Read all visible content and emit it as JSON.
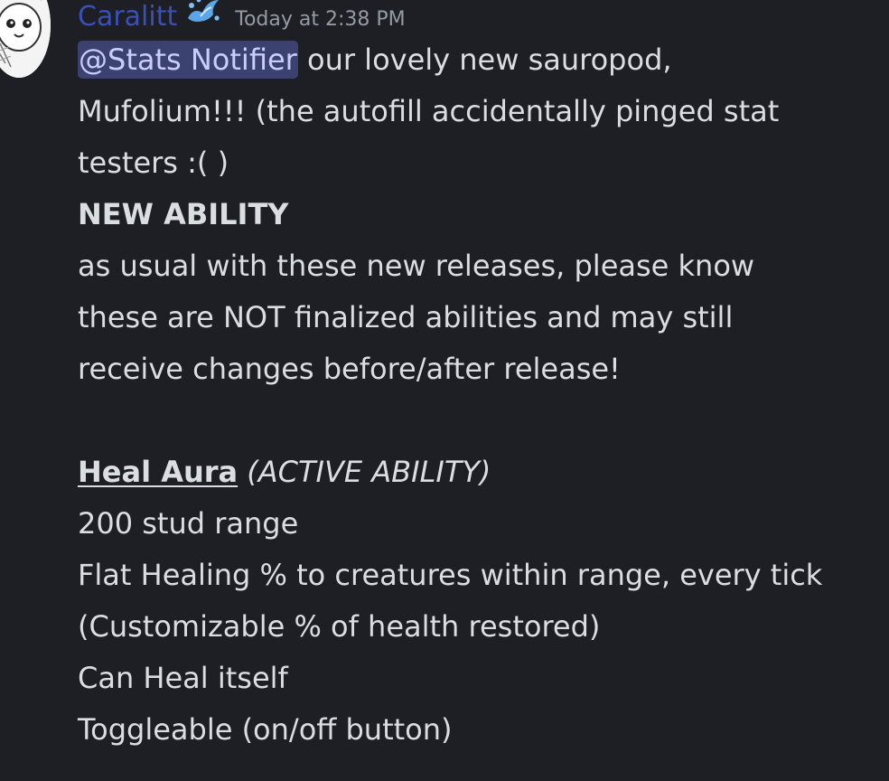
{
  "message": {
    "author": "Caralitt",
    "author_emoji_icon": "water-splash-icon",
    "timestamp": "Today at 2:38 PM",
    "mention": "@Stats Notifier",
    "line1_rest": " our lovely new sauropod,",
    "line2": "Mufolium!!! (the autofill accidentally pinged stat",
    "line3": "testers :( )",
    "heading": "NEW ABILITY",
    "para1": [
      "as usual with these new releases, please know",
      "these are NOT finalized abilities and may still",
      "receive changes before/after release!"
    ],
    "ability_name": "Heal Aura",
    "ability_type": " (ACTIVE ABILITY)",
    "details": [
      "200 stud range",
      "Flat Healing % to creatures within range, every tick",
      "(Customizable % of health restored)",
      "Can Heal itself",
      "Toggleable (on/off button)"
    ]
  },
  "colors": {
    "background": "#1e1f24",
    "username": "#3b4fb8",
    "mention_bg": "#3c4270",
    "text": "#dbdee1",
    "timestamp": "#949ba4"
  }
}
